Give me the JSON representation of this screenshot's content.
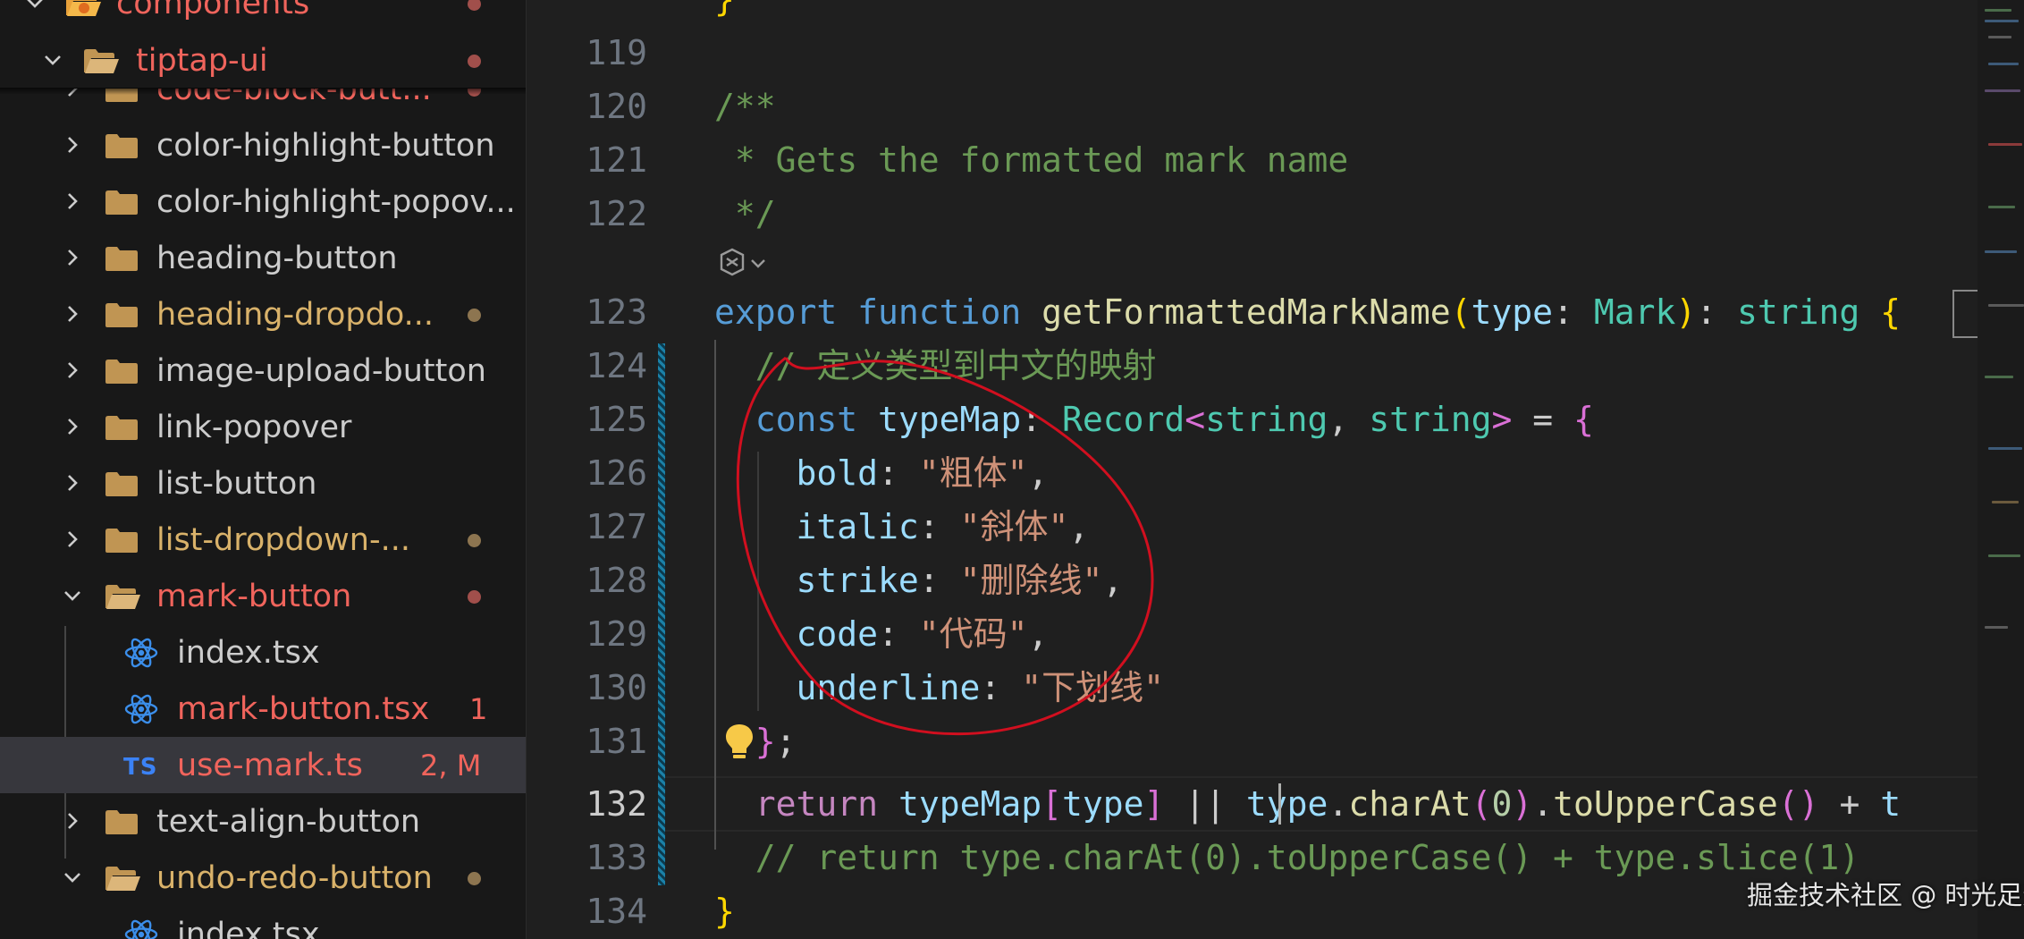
{
  "explorer": {
    "sticky": [
      {
        "label": "components",
        "color": "red",
        "dot": "red"
      },
      {
        "label": "tiptap-ui",
        "color": "red",
        "dot": "red"
      }
    ],
    "items": [
      {
        "label": "code-block-butt...",
        "color": "red",
        "dot": "red"
      },
      {
        "label": "color-highlight-button",
        "color": "plain"
      },
      {
        "label": "color-highlight-popov...",
        "color": "plain"
      },
      {
        "label": "heading-button",
        "color": "plain"
      },
      {
        "label": "heading-dropdo...",
        "color": "yellow",
        "dot": "yellow"
      },
      {
        "label": "image-upload-button",
        "color": "plain"
      },
      {
        "label": "link-popover",
        "color": "plain"
      },
      {
        "label": "list-button",
        "color": "plain"
      },
      {
        "label": "list-dropdown-...",
        "color": "yellow",
        "dot": "yellow"
      },
      {
        "label": "mark-button",
        "color": "red",
        "dot": "red",
        "expanded": true
      },
      {
        "label": "index.tsx",
        "color": "plain",
        "icon": "react-icon"
      },
      {
        "label": "mark-button.tsx",
        "color": "red",
        "icon": "react-icon",
        "badge": "1"
      },
      {
        "label": "use-mark.ts",
        "color": "red",
        "icon": "ts-icon",
        "badge": "2, M",
        "selected": true
      },
      {
        "label": "text-align-button",
        "color": "plain"
      },
      {
        "label": "undo-redo-button",
        "color": "yellow",
        "dot": "yellow",
        "expanded": true
      },
      {
        "label": "index.tsx",
        "color": "plain",
        "icon": "react-icon"
      }
    ]
  },
  "editor": {
    "lines": [
      {
        "n": "119",
        "text": ""
      },
      {
        "n": "120",
        "text": "/**"
      },
      {
        "n": "121",
        "text": " * Gets the formatted mark name"
      },
      {
        "n": "122",
        "text": " */"
      },
      {
        "n": "123",
        "text": "export function getFormattedMarkName(type: Mark): string {"
      },
      {
        "n": "124",
        "text": "  // 定义类型到中文的映射"
      },
      {
        "n": "125",
        "text": "  const typeMap: Record<string, string> = {"
      },
      {
        "n": "126",
        "text": "    bold: \"粗体\","
      },
      {
        "n": "127",
        "text": "    italic: \"斜体\","
      },
      {
        "n": "128",
        "text": "    strike: \"删除线\","
      },
      {
        "n": "129",
        "text": "    code: \"代码\","
      },
      {
        "n": "130",
        "text": "    underline: \"下划线\""
      },
      {
        "n": "131",
        "text": "  };"
      },
      {
        "n": "132",
        "text": "  return typeMap[type] || type.charAt(0).toUpperCase() + t"
      },
      {
        "n": "133",
        "text": "  // return type.charAt(0).toUpperCase() + type.slice(1)"
      },
      {
        "n": "134",
        "text": "}"
      }
    ],
    "active_line": "132",
    "theme_colors": {
      "comment": "#6a9955",
      "keyword": "#569cd6",
      "control": "#c586c0",
      "function": "#dcdcaa",
      "type": "#4ec9b0",
      "variable": "#9cdcfe",
      "string": "#ce9178",
      "number": "#b5cea8",
      "modified_file": "#f0645c",
      "annotation_circle": "#d10f1f"
    }
  },
  "watermark": "掘金技术社区 @ 时光足迹"
}
